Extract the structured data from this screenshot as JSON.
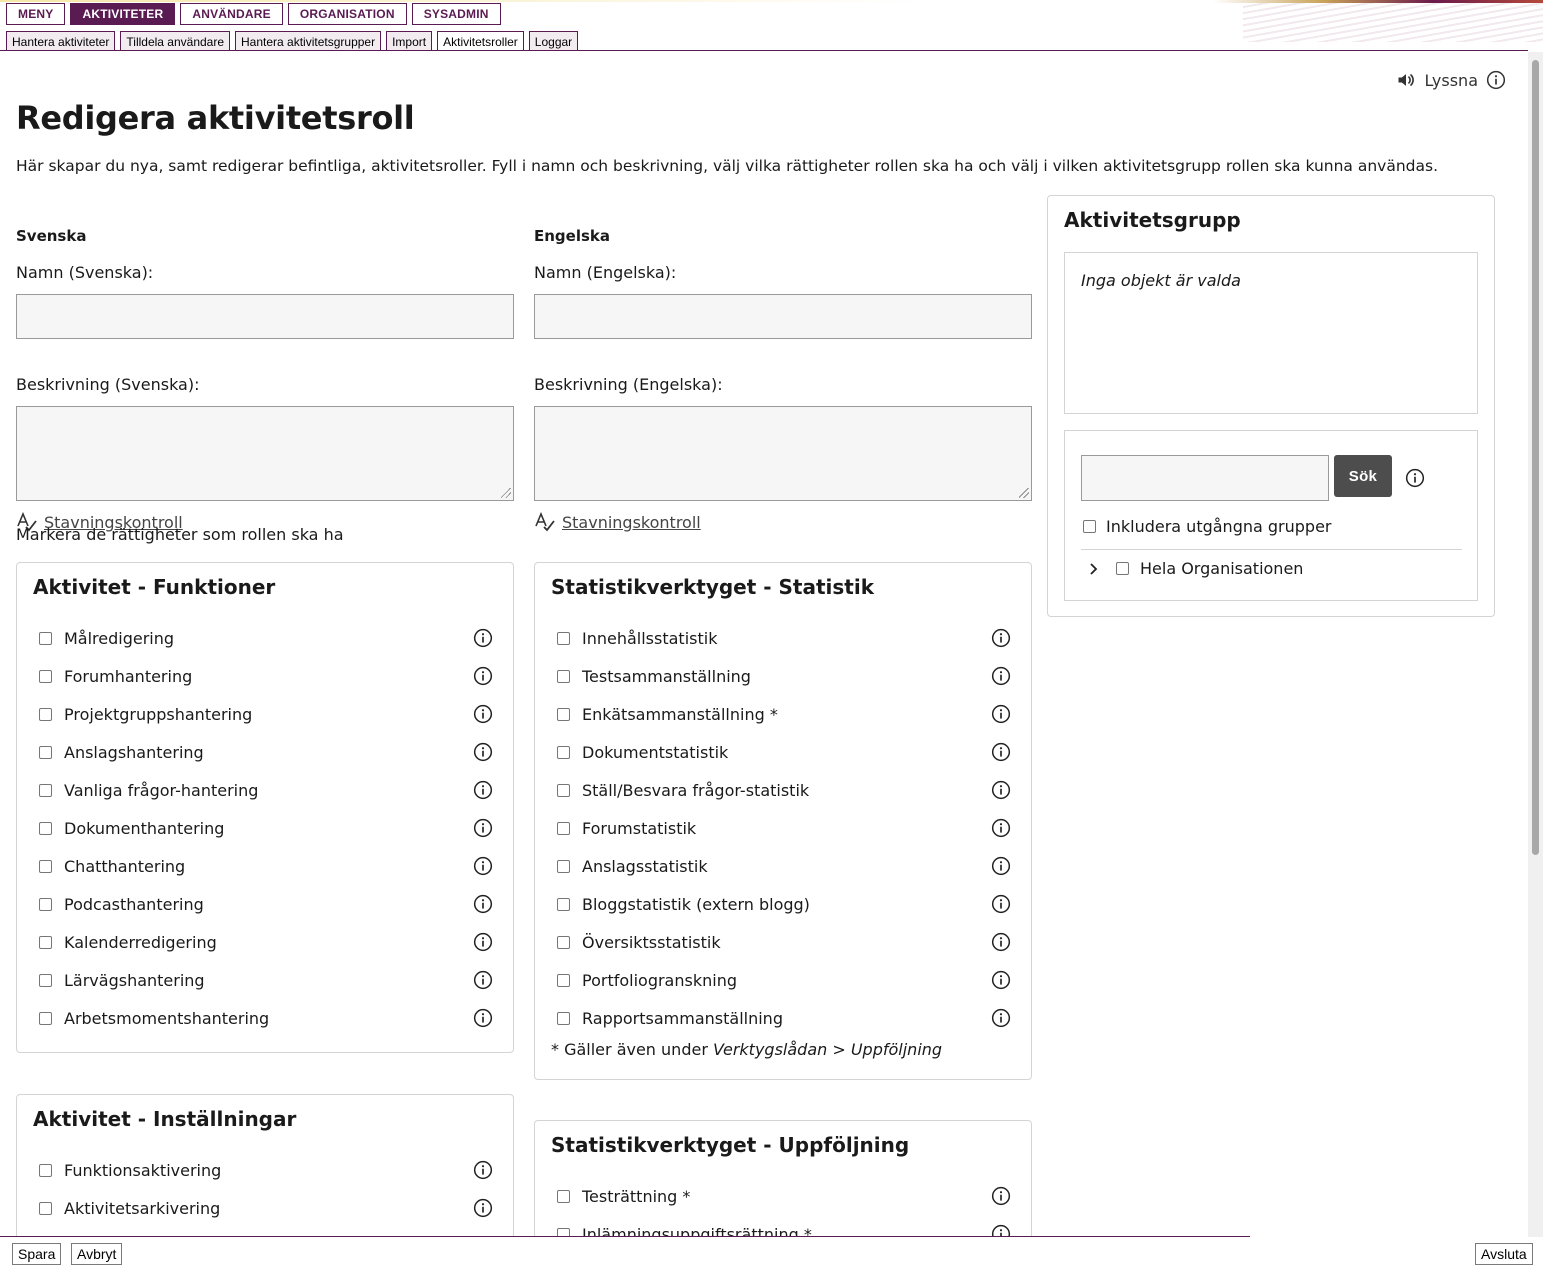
{
  "main_nav": [
    {
      "label": "MENY",
      "active": false
    },
    {
      "label": "AKTIVITETER",
      "active": true
    },
    {
      "label": "ANVÄNDARE",
      "active": false
    },
    {
      "label": "ORGANISATION",
      "active": false
    },
    {
      "label": "SYSADMIN",
      "active": false
    }
  ],
  "sub_nav": [
    {
      "label": "Hantera aktiviteter",
      "active": false
    },
    {
      "label": "Tilldela användare",
      "active": false
    },
    {
      "label": "Hantera aktivitetsgrupper",
      "active": false
    },
    {
      "label": "Import",
      "active": false
    },
    {
      "label": "Aktivitetsroller",
      "active": true
    },
    {
      "label": "Loggar",
      "active": false
    }
  ],
  "listen_label": "Lyssna",
  "page_title": "Redigera aktivitetsroll",
  "intro": "Här skapar du nya, samt redigerar befintliga, aktivitetsroller. Fyll i namn och beskrivning, välj vilka rättigheter rollen ska ha och välj i vilken aktivitetsgrupp rollen ska kunna användas.",
  "swedish": {
    "heading": "Svenska",
    "name_label": "Namn (Svenska):",
    "name_value": "",
    "desc_label": "Beskrivning (Svenska):",
    "desc_value": "",
    "spell_label": "Stavningskontroll"
  },
  "english": {
    "heading": "Engelska",
    "name_label": "Namn (Engelska):",
    "name_value": "",
    "desc_label": "Beskrivning (Engelska):",
    "desc_value": "",
    "spell_label": "Stavningskontroll"
  },
  "mark_rights": "Markera de rättigheter som rollen ska ha",
  "panels": {
    "funktioner": {
      "title": "Aktivitet - Funktioner",
      "items": [
        "Målredigering",
        "Forumhantering",
        "Projektgruppshantering",
        "Anslagshantering",
        "Vanliga frågor-hantering",
        "Dokumenthantering",
        "Chatthantering",
        "Podcasthantering",
        "Kalenderredigering",
        "Lärvägshantering",
        "Arbetsmomentshantering"
      ]
    },
    "statistik": {
      "title": "Statistikverktyget - Statistik",
      "items": [
        "Innehållsstatistik",
        "Testsammanställning",
        "Enkätsammanställning *",
        "Dokumentstatistik",
        "Ställ/Besvara frågor-statistik",
        "Forumstatistik",
        "Anslagsstatistik",
        "Bloggstatistik (extern blogg)",
        "Översiktsstatistik",
        "Portfoliogranskning",
        "Rapportsammanställning"
      ],
      "footnote_prefix": "* Gäller även under ",
      "footnote_path_a": "Verktygslådan",
      "footnote_sep": " > ",
      "footnote_path_b": "Uppföljning"
    },
    "installningar": {
      "title": "Aktivitet - Inställningar",
      "items": [
        "Funktionsaktivering",
        "Aktivitetsarkivering"
      ]
    },
    "uppfoljning": {
      "title": "Statistikverktyget - Uppföljning",
      "items": [
        "Testrättning *",
        "Inlämningsuppgiftsrättning *"
      ]
    }
  },
  "group": {
    "title": "Aktivitetsgrupp",
    "empty_text": "Inga objekt är valda",
    "search_value": "",
    "search_button": "Sök",
    "include_expired": "Inkludera utgångna grupper",
    "tree_root": "Hela Organisationen"
  },
  "actions": {
    "save": "Spara",
    "cancel": "Avbryt",
    "close": "Avsluta"
  }
}
